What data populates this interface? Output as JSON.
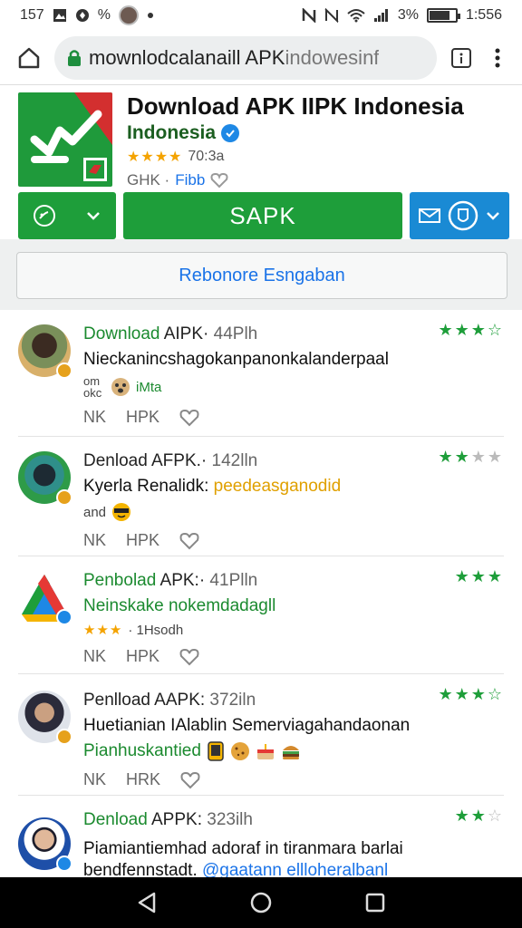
{
  "status": {
    "left_time": "157",
    "left_percent": "%",
    "battery_percent": "3%",
    "clock": "1:556"
  },
  "browser": {
    "url_main": "mownlodcalanaill APK",
    "url_dim": "indowesinf"
  },
  "app": {
    "title": "Download APK IIPK Indonesia",
    "developer": "Indonesia",
    "rating_stars": "★★★★",
    "rating_text": "70:3a",
    "meta_left": "GHK ·",
    "meta_link": "Fibb"
  },
  "actions": {
    "main_label": "SAPK",
    "secondary_label": "Rebonore Esngaban"
  },
  "reviews": [
    {
      "name": "Download",
      "head_rest": " AIPK·",
      "meta": " 44Plh",
      "text": "Nieckanincshagokanpanonkalanderpaal",
      "sub": "om okc",
      "sub_tag": "iMta",
      "act1": "NK",
      "act2": "HPK",
      "stars": "★★★",
      "stars_off": "☆"
    },
    {
      "name": "Denload",
      "head_rest": " AFPK.·",
      "meta": " 142lln",
      "text": "Kyerla Renalidk:",
      "text_highlight": "peedeasganodid",
      "sub": "and",
      "act1": "NK",
      "act2": "HPK",
      "stars": "★★",
      "stars_off": "★"
    },
    {
      "name": "Penbolad",
      "head_rest": " APK:·",
      "meta": " 41Plln",
      "text": "Neinskake nokemdadagll",
      "sub_stars": "★★★",
      "sub": "· 1Hsodh",
      "act1": "NK",
      "act2": "HPK",
      "stars": "★★★",
      "stars_off": ""
    },
    {
      "name": "Penlload",
      "head_rest": " AAPK:",
      "meta": " 372iln",
      "text": "Huetianian IAlablin Semerviagahandaonan",
      "text2": "Pianhuskantied",
      "act1": "NK",
      "act2": "HRK",
      "stars": "★★★",
      "stars_off": "☆"
    },
    {
      "name": "Denload",
      "head_rest": " APPK:",
      "meta": " 323ilh",
      "text": "Piamiantiemhad adoraf in tiranmara barlai",
      "text2a": "bendfennstadt.",
      "text2b": "@gaatann ellloheralbanl",
      "stars": "★★",
      "stars_off": "☆"
    }
  ]
}
